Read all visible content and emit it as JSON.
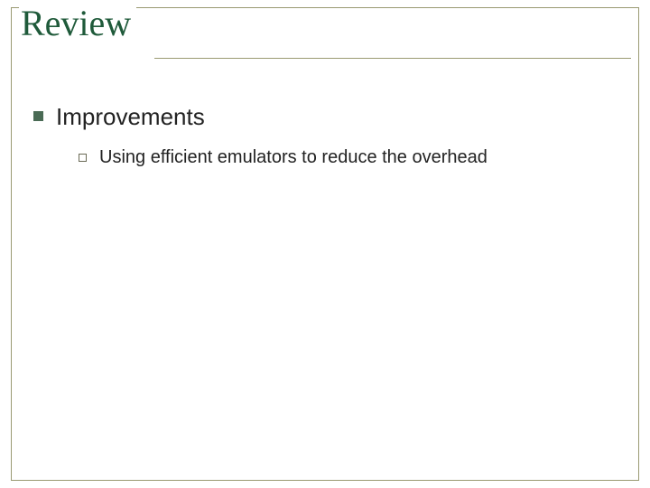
{
  "slide": {
    "title": "Review",
    "items": [
      {
        "label": "Improvements",
        "sub": [
          {
            "label": "Using efficient emulators to reduce the overhead"
          }
        ]
      }
    ]
  }
}
